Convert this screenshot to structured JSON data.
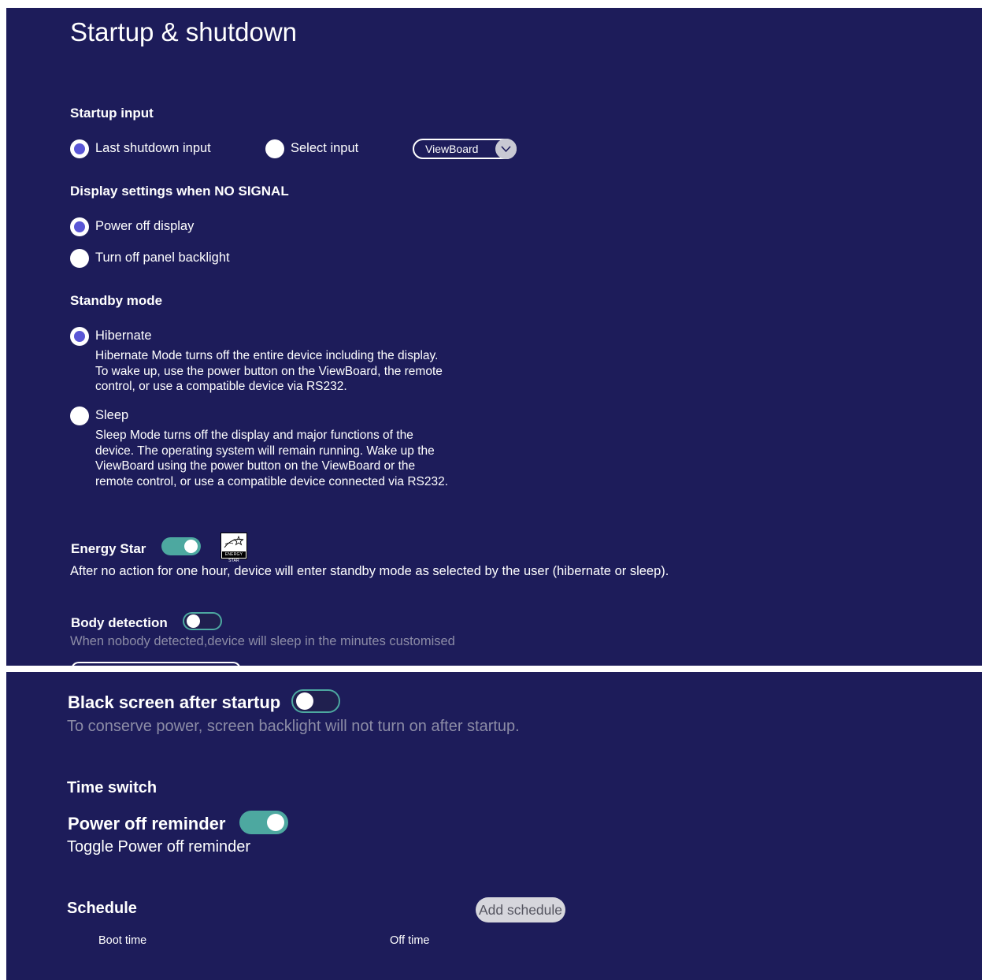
{
  "page": {
    "title": "Startup & shutdown"
  },
  "startup_input": {
    "title": "Startup input",
    "options": [
      {
        "label": "Last shutdown input",
        "checked": true
      },
      {
        "label": "Select input",
        "checked": false
      }
    ],
    "select": {
      "value": "ViewBoard"
    }
  },
  "no_signal": {
    "title": "Display settings when NO SIGNAL",
    "options": [
      {
        "label": "Power off display",
        "checked": true
      },
      {
        "label": "Turn off panel backlight",
        "checked": false
      }
    ]
  },
  "standby": {
    "title": "Standby mode",
    "options": [
      {
        "label": "Hibernate",
        "checked": true,
        "description": "Hibernate Mode turns off the entire device including the display. To wake up, use the power button on the ViewBoard, the remote control, or use a compatible device via RS232."
      },
      {
        "label": "Sleep",
        "checked": false,
        "description": "Sleep Mode turns off the display and major functions of the device. The operating system will remain running. Wake up the ViewBoard using the power button on the ViewBoard or the remote control, or use a compatible device connected via RS232."
      }
    ]
  },
  "energy_star": {
    "label": "Energy Star",
    "enabled": true,
    "logo_text": "ENERGY STAR",
    "description": "After no action for one hour, device will enter standby mode as selected by the user (hibernate or sleep)."
  },
  "body_detection": {
    "label": "Body detection",
    "enabled": false,
    "description": "When nobody detected,device will sleep in the minutes customised"
  },
  "black_screen": {
    "label": "Black screen after startup",
    "enabled": false,
    "description": "To conserve power, screen backlight will not turn on after startup."
  },
  "time_switch": {
    "title": "Time switch"
  },
  "power_off_reminder": {
    "label": "Power off reminder",
    "enabled": true,
    "description": "Toggle Power off reminder"
  },
  "schedule": {
    "title": "Schedule",
    "add_label": "Add schedule",
    "columns": [
      "Boot time",
      "Off time"
    ]
  },
  "colors": {
    "background": "#1d1c5a",
    "accent": "#4da8a0",
    "radio_selected": "#5a56d6"
  }
}
